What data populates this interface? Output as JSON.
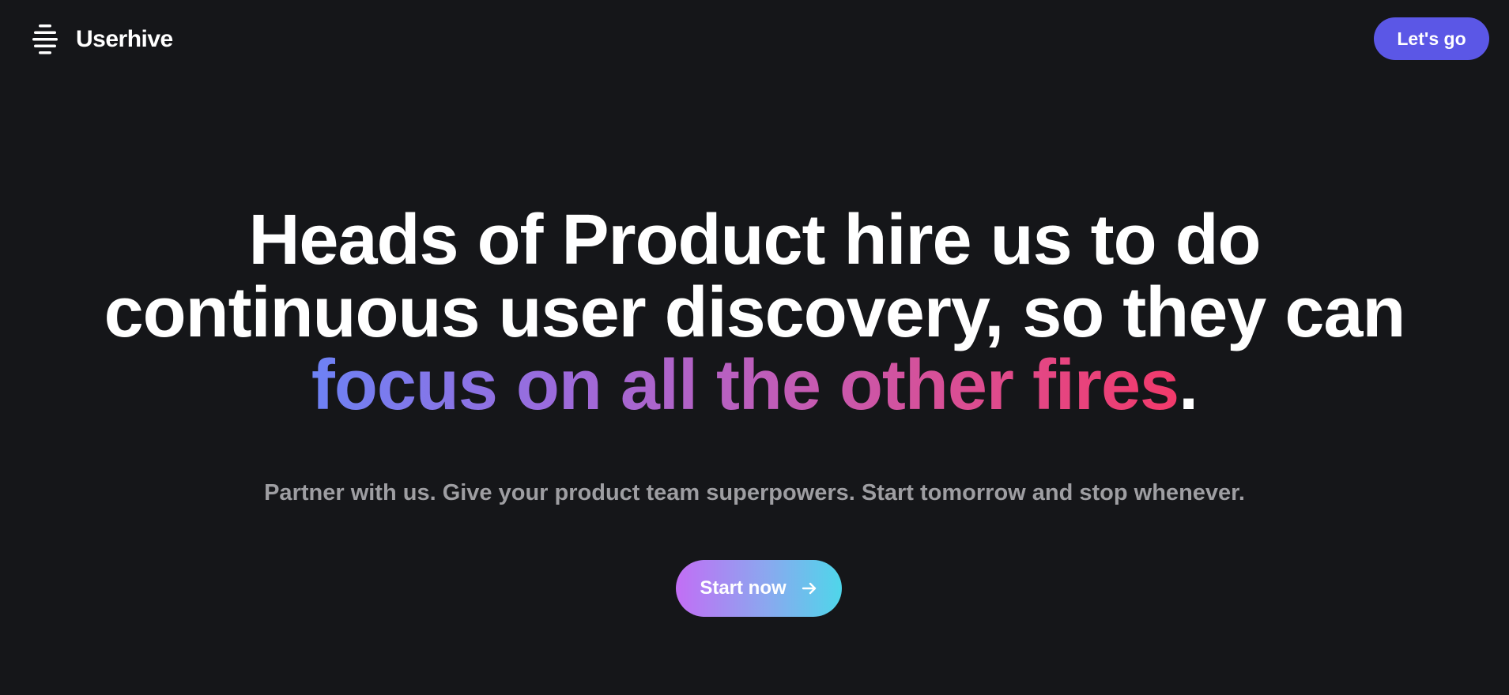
{
  "header": {
    "brand_name": "Userhive",
    "brand_icon": "stacked-lines-logo-icon",
    "cta_label": "Let's go",
    "cta_color": "#5b57e6"
  },
  "hero": {
    "headline_line1": "Heads of Product hire us to do",
    "headline_line2": "continuous user discovery, so they can",
    "headline_highlight": "focus on all the other fires",
    "headline_end": ".",
    "subtext": "Partner with us. Give your product team superpowers. Start tomorrow and stop whenever.",
    "start_label": "Start now",
    "start_icon": "arrow-right-icon"
  },
  "colors": {
    "background": "#151619",
    "highlight_gradient": [
      "#6d82f5",
      "#9b6bdc",
      "#c25cb6",
      "#e04a8a",
      "#f23a6b"
    ],
    "start_gradient": [
      "#c26ef5",
      "#8aa8ef",
      "#4fd6ea"
    ],
    "subtext": "#9e9ea2"
  }
}
